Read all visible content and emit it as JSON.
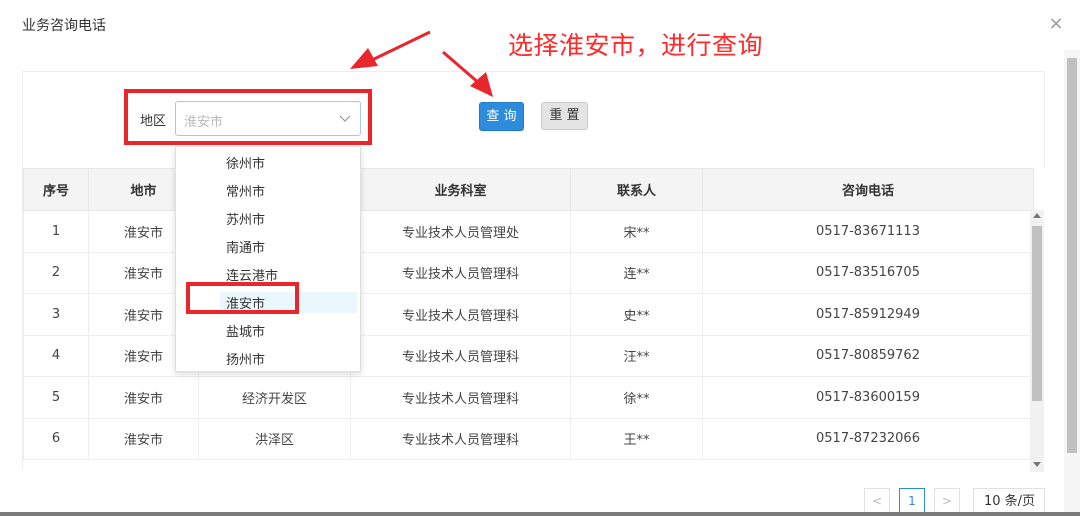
{
  "dialog": {
    "title": "业务咨询电话",
    "close_label": "×"
  },
  "annotation": {
    "text": "选择淮安市，进行查询",
    "color": "#ff2a2a"
  },
  "filter": {
    "region_label": "地区",
    "region_value": "淮安市",
    "query_label": "查 询",
    "reset_label": "重 置"
  },
  "dropdown": {
    "options": [
      "徐州市",
      "常州市",
      "苏州市",
      "南通市",
      "连云港市",
      "淮安市",
      "盐城市",
      "扬州市"
    ],
    "highlighted": "淮安市"
  },
  "table": {
    "headers": [
      "序号",
      "地市",
      "",
      "业务科室",
      "联系人",
      "咨询电话"
    ],
    "rows": [
      [
        "1",
        "淮安市",
        "",
        "专业技术人员管理处",
        "宋**",
        "0517-83671113"
      ],
      [
        "2",
        "淮安市",
        "",
        "专业技术人员管理科",
        "连**",
        "0517-83516705"
      ],
      [
        "3",
        "淮安市",
        "",
        "专业技术人员管理科",
        "史**",
        "0517-85912949"
      ],
      [
        "4",
        "淮安市",
        "",
        "专业技术人员管理科",
        "汪**",
        "0517-80859762"
      ],
      [
        "5",
        "淮安市",
        "经济开发区",
        "专业技术人员管理科",
        "徐**",
        "0517-83600159"
      ],
      [
        "6",
        "淮安市",
        "洪泽区",
        "专业技术人员管理科",
        "王**",
        "0517-87232066"
      ]
    ]
  },
  "pagination": {
    "prev": "<",
    "current_page": "1",
    "next": ">",
    "page_size": "10 条/页"
  },
  "colors": {
    "accent": "#2d8cdb",
    "highlight_box": "#e8262c"
  }
}
